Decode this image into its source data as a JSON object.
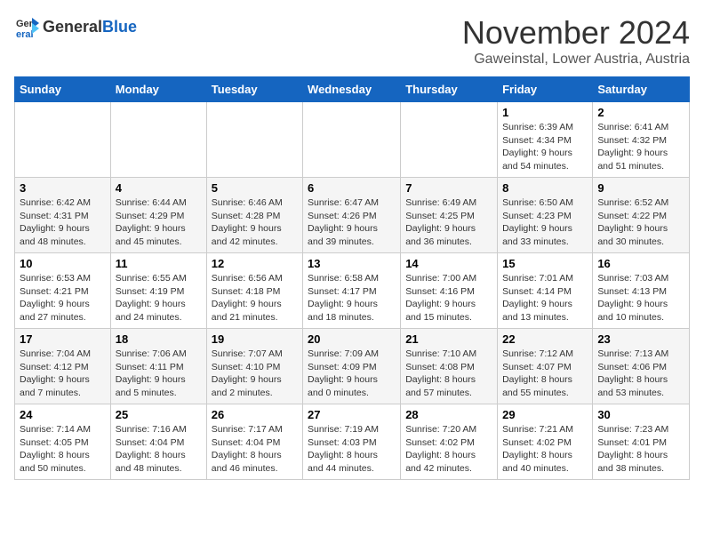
{
  "header": {
    "logo_general": "General",
    "logo_blue": "Blue",
    "month_year": "November 2024",
    "location": "Gaweinstal, Lower Austria, Austria"
  },
  "columns": [
    "Sunday",
    "Monday",
    "Tuesday",
    "Wednesday",
    "Thursday",
    "Friday",
    "Saturday"
  ],
  "weeks": [
    [
      {
        "day": "",
        "info": ""
      },
      {
        "day": "",
        "info": ""
      },
      {
        "day": "",
        "info": ""
      },
      {
        "day": "",
        "info": ""
      },
      {
        "day": "",
        "info": ""
      },
      {
        "day": "1",
        "info": "Sunrise: 6:39 AM\nSunset: 4:34 PM\nDaylight: 9 hours\nand 54 minutes."
      },
      {
        "day": "2",
        "info": "Sunrise: 6:41 AM\nSunset: 4:32 PM\nDaylight: 9 hours\nand 51 minutes."
      }
    ],
    [
      {
        "day": "3",
        "info": "Sunrise: 6:42 AM\nSunset: 4:31 PM\nDaylight: 9 hours\nand 48 minutes."
      },
      {
        "day": "4",
        "info": "Sunrise: 6:44 AM\nSunset: 4:29 PM\nDaylight: 9 hours\nand 45 minutes."
      },
      {
        "day": "5",
        "info": "Sunrise: 6:46 AM\nSunset: 4:28 PM\nDaylight: 9 hours\nand 42 minutes."
      },
      {
        "day": "6",
        "info": "Sunrise: 6:47 AM\nSunset: 4:26 PM\nDaylight: 9 hours\nand 39 minutes."
      },
      {
        "day": "7",
        "info": "Sunrise: 6:49 AM\nSunset: 4:25 PM\nDaylight: 9 hours\nand 36 minutes."
      },
      {
        "day": "8",
        "info": "Sunrise: 6:50 AM\nSunset: 4:23 PM\nDaylight: 9 hours\nand 33 minutes."
      },
      {
        "day": "9",
        "info": "Sunrise: 6:52 AM\nSunset: 4:22 PM\nDaylight: 9 hours\nand 30 minutes."
      }
    ],
    [
      {
        "day": "10",
        "info": "Sunrise: 6:53 AM\nSunset: 4:21 PM\nDaylight: 9 hours\nand 27 minutes."
      },
      {
        "day": "11",
        "info": "Sunrise: 6:55 AM\nSunset: 4:19 PM\nDaylight: 9 hours\nand 24 minutes."
      },
      {
        "day": "12",
        "info": "Sunrise: 6:56 AM\nSunset: 4:18 PM\nDaylight: 9 hours\nand 21 minutes."
      },
      {
        "day": "13",
        "info": "Sunrise: 6:58 AM\nSunset: 4:17 PM\nDaylight: 9 hours\nand 18 minutes."
      },
      {
        "day": "14",
        "info": "Sunrise: 7:00 AM\nSunset: 4:16 PM\nDaylight: 9 hours\nand 15 minutes."
      },
      {
        "day": "15",
        "info": "Sunrise: 7:01 AM\nSunset: 4:14 PM\nDaylight: 9 hours\nand 13 minutes."
      },
      {
        "day": "16",
        "info": "Sunrise: 7:03 AM\nSunset: 4:13 PM\nDaylight: 9 hours\nand 10 minutes."
      }
    ],
    [
      {
        "day": "17",
        "info": "Sunrise: 7:04 AM\nSunset: 4:12 PM\nDaylight: 9 hours\nand 7 minutes."
      },
      {
        "day": "18",
        "info": "Sunrise: 7:06 AM\nSunset: 4:11 PM\nDaylight: 9 hours\nand 5 minutes."
      },
      {
        "day": "19",
        "info": "Sunrise: 7:07 AM\nSunset: 4:10 PM\nDaylight: 9 hours\nand 2 minutes."
      },
      {
        "day": "20",
        "info": "Sunrise: 7:09 AM\nSunset: 4:09 PM\nDaylight: 9 hours\nand 0 minutes."
      },
      {
        "day": "21",
        "info": "Sunrise: 7:10 AM\nSunset: 4:08 PM\nDaylight: 8 hours\nand 57 minutes."
      },
      {
        "day": "22",
        "info": "Sunrise: 7:12 AM\nSunset: 4:07 PM\nDaylight: 8 hours\nand 55 minutes."
      },
      {
        "day": "23",
        "info": "Sunrise: 7:13 AM\nSunset: 4:06 PM\nDaylight: 8 hours\nand 53 minutes."
      }
    ],
    [
      {
        "day": "24",
        "info": "Sunrise: 7:14 AM\nSunset: 4:05 PM\nDaylight: 8 hours\nand 50 minutes."
      },
      {
        "day": "25",
        "info": "Sunrise: 7:16 AM\nSunset: 4:04 PM\nDaylight: 8 hours\nand 48 minutes."
      },
      {
        "day": "26",
        "info": "Sunrise: 7:17 AM\nSunset: 4:04 PM\nDaylight: 8 hours\nand 46 minutes."
      },
      {
        "day": "27",
        "info": "Sunrise: 7:19 AM\nSunset: 4:03 PM\nDaylight: 8 hours\nand 44 minutes."
      },
      {
        "day": "28",
        "info": "Sunrise: 7:20 AM\nSunset: 4:02 PM\nDaylight: 8 hours\nand 42 minutes."
      },
      {
        "day": "29",
        "info": "Sunrise: 7:21 AM\nSunset: 4:02 PM\nDaylight: 8 hours\nand 40 minutes."
      },
      {
        "day": "30",
        "info": "Sunrise: 7:23 AM\nSunset: 4:01 PM\nDaylight: 8 hours\nand 38 minutes."
      }
    ]
  ]
}
